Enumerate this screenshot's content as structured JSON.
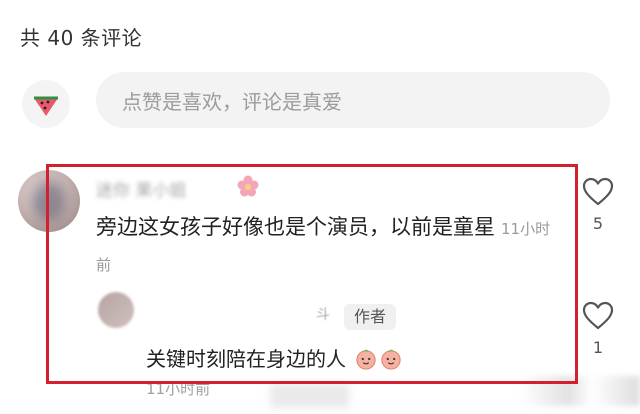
{
  "header": {
    "comment_count_title": "共 40 条评论"
  },
  "composer": {
    "avatar_icon": "watermelon-icon",
    "placeholder": "点赞是喜欢，评论是真爱"
  },
  "comment": {
    "username": "迷你 果小姐",
    "text": "旁边这女孩子好像也是个演员，以前是童星",
    "time": "11小时前",
    "like_count": "5",
    "highlight_color": "#d4202e"
  },
  "reply": {
    "username": "  ",
    "username_tail": "斗",
    "author_badge": "作者",
    "text": "关键时刻陪在身边的人",
    "emoji_icon": "peach-face-icon",
    "time": "11小时前",
    "like_count": "1"
  }
}
